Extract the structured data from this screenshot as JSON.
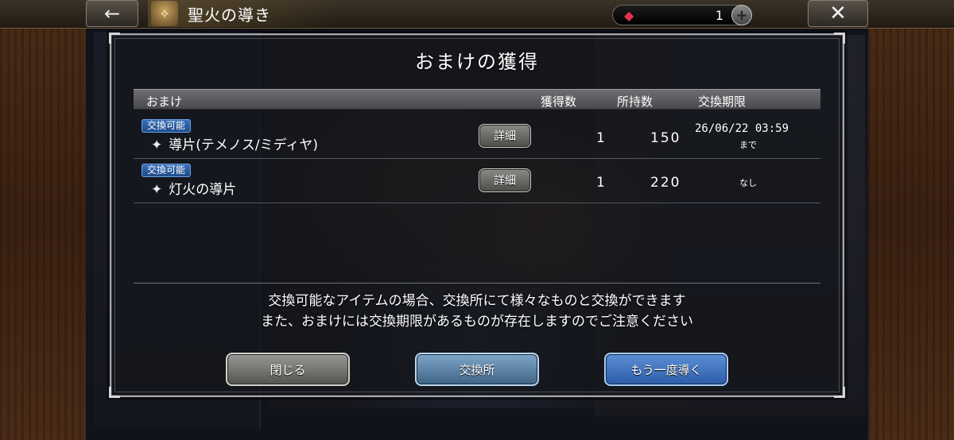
{
  "header": {
    "back_icon": "left-arrow-icon",
    "screen_title": "聖火の導き",
    "title_icon": "torch-icon",
    "gem_icon": "gem-icon",
    "gem_count": "1",
    "plus_icon": "plus-icon",
    "close_icon": "close-icon"
  },
  "modal": {
    "title": "おまけの獲得",
    "columns": {
      "item": "おまけ",
      "acquired": "獲得数",
      "owned": "所持数",
      "expiry": "交換期限"
    },
    "rows": [
      {
        "badge": "交換可能",
        "icon": "sparkle-icon",
        "name": "導片(テメノス/ミディヤ)",
        "detail_label": "詳細",
        "acquired": "1",
        "owned": "150",
        "expiry": "26/06/22 03:59",
        "expiry_suffix": "まで"
      },
      {
        "badge": "交換可能",
        "icon": "sparkle-icon",
        "name": "灯火の導片",
        "detail_label": "詳細",
        "acquired": "1",
        "owned": "220",
        "expiry": "なし"
      }
    ],
    "notice_line1": "交換可能なアイテムの場合、交換所にて様々なものと交換ができます",
    "notice_line2": "また、おまけには交換期限があるものが存在しますのでご注意ください",
    "buttons": {
      "close": "閉じる",
      "exchange": "交換所",
      "again": "もう一度導く"
    }
  },
  "colors": {
    "badge_blue": "#2a5fa3",
    "again_button_blue": "#3e72c0",
    "exchange_button_blue": "#5a86ab",
    "close_button_gray": "#777571",
    "gem_red": "#e0344a"
  }
}
